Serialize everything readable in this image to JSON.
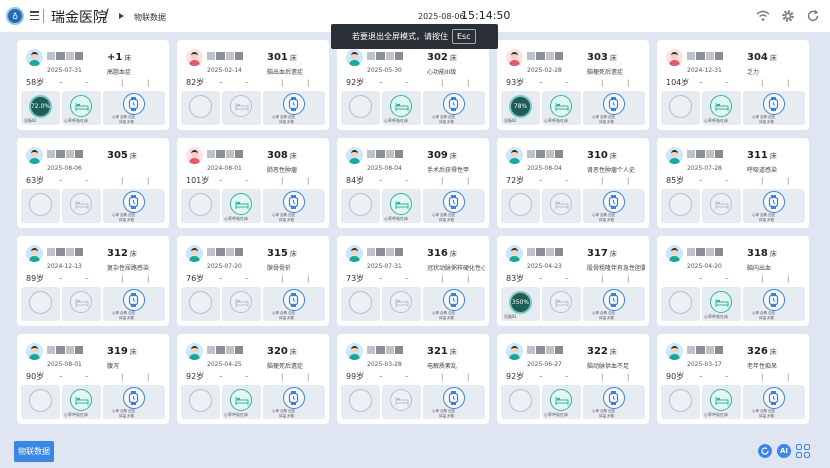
{
  "header": {
    "hospital_name": "瑞金医院",
    "crumb_separator": "/",
    "current_page": "物联数据",
    "date": "2025-08-06",
    "time": "15:14:50"
  },
  "toast": {
    "message": "若要退出全屏模式，请按住",
    "key": "Esc"
  },
  "labels": {
    "bed_unit": "床",
    "bed_status": "心率呼吸在床",
    "vitals_row1": "心率    血氧    血压",
    "vitals_row2": "体温    步数",
    "ring_default_label": "设备ID"
  },
  "cards": [
    {
      "bed": "+1",
      "date": "2025-07-31",
      "diag": "高脂血症",
      "age": "58岁",
      "female": false,
      "ring": "72.0%",
      "bed_active": true
    },
    {
      "bed": "301",
      "date": "2025-02-14",
      "diag": "脑出血后遗症",
      "age": "82岁",
      "female": true,
      "ring": "",
      "bed_active": false
    },
    {
      "bed": "302",
      "date": "2025-05-30",
      "diag": "心功能III级",
      "age": "92岁",
      "female": false,
      "ring": "",
      "bed_active": true
    },
    {
      "bed": "303",
      "date": "2025-02-28",
      "diag": "脑梗死后遗症",
      "age": "93岁",
      "female": true,
      "ring": "78%",
      "bed_active": true
    },
    {
      "bed": "304",
      "date": "2024-12-31",
      "diag": "乏力",
      "age": "104岁",
      "female": true,
      "ring": "",
      "bed_active": true
    },
    {
      "bed": "305",
      "date": "2025-08-06",
      "diag": "",
      "age": "63岁",
      "female": false,
      "ring": "",
      "bed_active": false
    },
    {
      "bed": "308",
      "date": "2024-08-01",
      "diag": "肺恶性肿瘤",
      "age": "101岁",
      "female": true,
      "ring": "",
      "bed_active": true
    },
    {
      "bed": "309",
      "date": "2025-08-04",
      "diag": "手术后获得性甲",
      "age": "84岁",
      "female": false,
      "ring": "",
      "bed_active": true
    },
    {
      "bed": "310",
      "date": "2025-08-04",
      "diag": "肾恶性肿瘤个人史",
      "age": "72岁",
      "female": false,
      "ring": "",
      "bed_active": false
    },
    {
      "bed": "311",
      "date": "2025-07-28",
      "diag": "呼吸道感染",
      "age": "85岁",
      "female": false,
      "ring": "",
      "bed_active": false
    },
    {
      "bed": "312",
      "date": "2024-12-13",
      "diag": "复杂性尿路感染",
      "age": "89岁",
      "female": false,
      "ring": "",
      "bed_active": false
    },
    {
      "bed": "315",
      "date": "2025-07-20",
      "diag": "髌骨骨折",
      "age": "76岁",
      "female": false,
      "ring": "",
      "bed_active": false
    },
    {
      "bed": "316",
      "date": "2025-07-31",
      "diag": "冠状动脉粥样硬化性心",
      "age": "73岁",
      "female": false,
      "ring": "",
      "bed_active": false
    },
    {
      "bed": "317",
      "date": "2025-04-23",
      "diag": "股骨粗隆伴有急性胆囊炎",
      "age": "83岁",
      "female": false,
      "ring": "350%",
      "bed_active": false
    },
    {
      "bed": "318",
      "date": "2025-04-20",
      "diag": "脑内出血",
      "age": "",
      "female": false,
      "ring": "",
      "bed_active": true
    },
    {
      "bed": "319",
      "date": "2025-08-01",
      "diag": "腹泻",
      "age": "90岁",
      "female": false,
      "ring": "",
      "bed_active": true
    },
    {
      "bed": "320",
      "date": "2025-04-25",
      "diag": "脑梗死后遗症",
      "age": "92岁",
      "female": false,
      "ring": "",
      "bed_active": true
    },
    {
      "bed": "321",
      "date": "2025-03-28",
      "diag": "电解质紊乱",
      "age": "99岁",
      "female": false,
      "ring": "",
      "bed_active": false
    },
    {
      "bed": "322",
      "date": "2025-06-27",
      "diag": "脑动脉供血不足",
      "age": "92岁",
      "female": false,
      "ring": "",
      "bed_active": true
    },
    {
      "bed": "326",
      "date": "2025-03-17",
      "diag": "老年性痴呆",
      "age": "90岁",
      "female": false,
      "ring": "",
      "bed_active": true
    }
  ],
  "footer": {
    "button": "物联数据",
    "ai": "AI"
  },
  "colors": {
    "accent": "#3a87e8",
    "ring_fill": "#1e5d57",
    "bed_active": "#2fb59b"
  }
}
